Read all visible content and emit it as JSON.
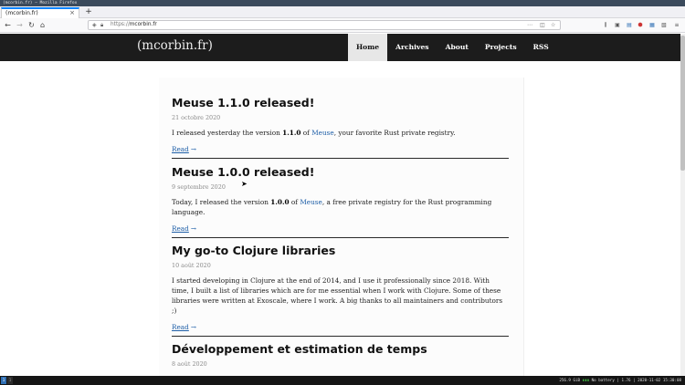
{
  "window": {
    "title": "(mcorbin.fr) — Mozilla Firefox"
  },
  "tabs": [
    {
      "label": "(mcorbin.fr)"
    }
  ],
  "toolbar": {
    "new_tab": "+",
    "back": "←",
    "forward": "→",
    "reload": "↻",
    "home": "⌂",
    "url_scheme": "https://",
    "url_host": "mcorbin.fr",
    "more": "⋯",
    "pocket": "◫",
    "star": "☆"
  },
  "site": {
    "title": "(mcorbin.fr)",
    "nav": [
      {
        "label": "Home",
        "active": true
      },
      {
        "label": "Archives",
        "active": false
      },
      {
        "label": "About",
        "active": false
      },
      {
        "label": "Projects",
        "active": false
      },
      {
        "label": "RSS",
        "active": false
      }
    ]
  },
  "posts": [
    {
      "title": "Meuse 1.1.0 released!",
      "date": "21 octobre 2020",
      "excerpt": [
        {
          "t": "I released yesterday the version "
        },
        {
          "t": "1.1.0",
          "b": true
        },
        {
          "t": " of "
        },
        {
          "t": "Meuse",
          "l": true
        },
        {
          "t": ", your favorite Rust private registry."
        }
      ],
      "read": "Read",
      "arrow": "→"
    },
    {
      "title": "Meuse 1.0.0 released!",
      "date": "9 septembre 2020",
      "excerpt": [
        {
          "t": "Today, I released the version "
        },
        {
          "t": "1.0.0",
          "b": true
        },
        {
          "t": " of "
        },
        {
          "t": "Meuse",
          "l": true
        },
        {
          "t": ", a free private registry for the Rust programming language."
        }
      ],
      "read": "Read",
      "arrow": "→"
    },
    {
      "title": "My go-to Clojure libraries",
      "date": "10 août 2020",
      "excerpt": [
        {
          "t": "I started developing in Clojure at the end of 2014, and I use it professionally since 2018. With time, I built a list of libraries which are for me essential when I work with Clojure. Some of these libraries were written at Exoscale, where I work. A big thanks to all maintainers and contributors ;)"
        }
      ],
      "read": "Read",
      "arrow": "→"
    },
    {
      "title": "Développement et estimation de temps",
      "date": "8 août 2020",
      "excerpt": [],
      "read": "",
      "arrow": ""
    }
  ],
  "statusbar": {
    "workspace_1": "1",
    "workspace_2": "1",
    "disk": "256.9 GiB",
    "battery": "No battery",
    "datetime": "1.76 | 2020-11-02 15:30:08"
  },
  "colors": {
    "header_bg": "#1c1c1c",
    "nav_active_bg": "#e7e7e7",
    "link": "#2060a8",
    "tab_accent": "#0a84ff"
  }
}
